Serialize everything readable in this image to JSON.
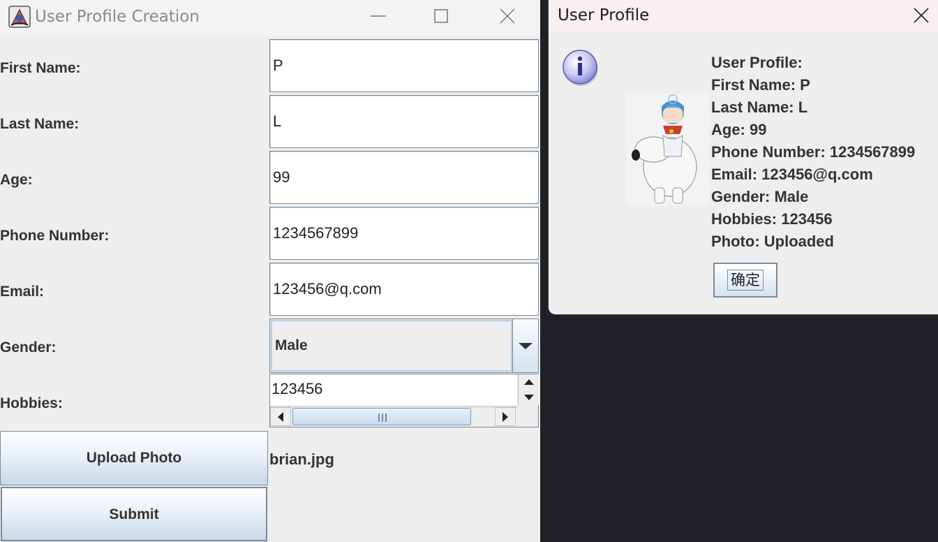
{
  "main_window": {
    "title": "User Profile Creation",
    "fields": {
      "first_name_label": "First Name:",
      "first_name_value": "P",
      "last_name_label": "Last Name:",
      "last_name_value": "L",
      "age_label": "Age:",
      "age_value": "99",
      "phone_label": "Phone Number:",
      "phone_value": "1234567899",
      "email_label": "Email:",
      "email_value": "123456@q.com",
      "gender_label": "Gender:",
      "gender_value": "Male",
      "hobbies_label": "Hobbies:",
      "hobbies_value": "123456"
    },
    "upload_button": "Upload Photo",
    "uploaded_file": "brian.jpg",
    "submit_button": "Submit",
    "titlebar_icons": [
      "java-app-icon",
      "minimize-icon",
      "maximize-icon",
      "close-icon"
    ]
  },
  "dialog": {
    "title": "User Profile",
    "lines": [
      "User Profile:",
      "First Name: P",
      "Last Name: L",
      "Age: 99",
      "Phone Number: 1234567899",
      "Email: 123456@q.com",
      "Gender: Male",
      "Hobbies: 123456",
      "Photo: Uploaded"
    ],
    "ok_button": "确定",
    "icons": [
      "info-icon",
      "close-icon"
    ]
  }
}
